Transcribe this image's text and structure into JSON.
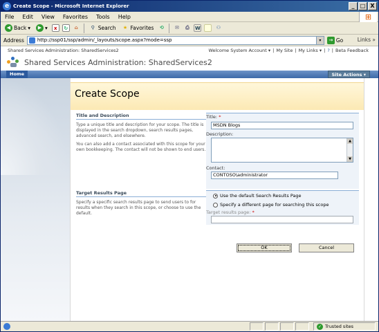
{
  "window": {
    "title": "Create Scope - Microsoft Internet Explorer",
    "min": "_",
    "max": "□",
    "close": "X"
  },
  "menu": [
    "File",
    "Edit",
    "View",
    "Favorites",
    "Tools",
    "Help"
  ],
  "toolbar": {
    "back": "Back",
    "search": "Search",
    "favorites": "Favorites"
  },
  "address": {
    "label": "Address",
    "url": "http://ssp01/ssp/admin/_layouts/scope.aspx?mode=ssp",
    "go": "Go",
    "links": "Links"
  },
  "site": {
    "breadcrumb": "Shared Services Administration: SharedServices2",
    "welcome": "Welcome System Account ▾",
    "my_site": "My Site",
    "my_links": "My Links ▾",
    "help": "Beta Feedback",
    "title": "Shared Services Administration: SharedServices2",
    "home_tab": "Home",
    "site_actions": "Site Actions ▾"
  },
  "page": {
    "title": "Create Scope",
    "section1": {
      "heading": "Title and Description",
      "desc1": "Type a unique title and description for your scope. The title is displayed in the search dropdown, search results pages, advanced search, and elsewhere.",
      "desc2": "You can also add a contact associated with this scope for your own bookkeeping. The contact will not be shown to end users.",
      "title_label": "Title:",
      "required_mark": "*",
      "title_value": "MSDN Blogs",
      "description_label": "Description:",
      "contact_label": "Contact:",
      "contact_value": "CONTOSO\\administrator"
    },
    "section2": {
      "heading": "Target Results Page",
      "desc": "Specify a specific search results page to send users to for results when they search in this scope, or choose to use the default.",
      "opt_default": "Use the default Search Results Page",
      "opt_specify": "Specify a different page for searching this scope",
      "target_label": "Target results page:",
      "target_value": ""
    },
    "ok": "OK",
    "cancel": "Cancel"
  },
  "status": {
    "zone": "Trusted sites"
  }
}
